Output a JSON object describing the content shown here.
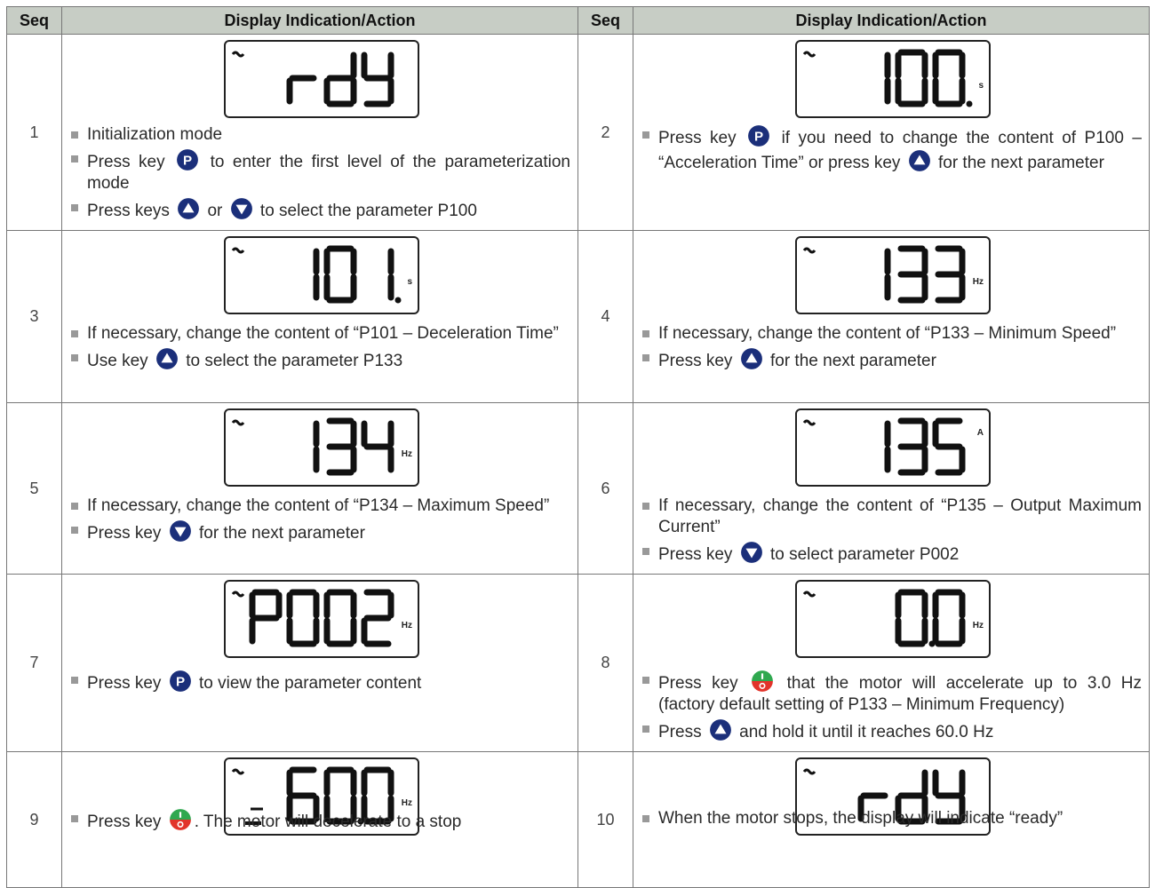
{
  "headers": {
    "seq": "Seq",
    "action": "Display Indication/Action"
  },
  "colors": {
    "header_bg": "#c7cdc5",
    "key_blue": "#1b2f7a",
    "run_green": "#2fa84f",
    "stop_red": "#e2332a"
  },
  "steps": [
    {
      "num": "1",
      "display": "rdY",
      "unit": "",
      "text": [
        "Initialization mode",
        "Press key [P] to enter the first level of the parameterization mode",
        "Press keys [UP] or [DOWN] to select the parameter P100"
      ]
    },
    {
      "num": "2",
      "display": "P 100.",
      "unit": "s",
      "text": [
        "Press key [P] if you need to change the content of P100 – “Acceleration Time” or press key [UP] for the next parameter"
      ]
    },
    {
      "num": "3",
      "display": "P 101.",
      "unit": "s",
      "text": [
        "If necessary, change the content of “P101 – Deceleration Time”",
        "Use key [UP] to select the parameter P133"
      ]
    },
    {
      "num": "4",
      "display": "P 133",
      "unit": "Hz",
      "text": [
        "If necessary, change the content of “P133 – Minimum Speed”",
        "Press key [UP] for the next parameter"
      ]
    },
    {
      "num": "5",
      "display": "P 134",
      "unit": "Hz",
      "text": [
        "If necessary, change the content of “P134 – Maximum Speed”",
        "Press key [DOWN] for the next parameter"
      ]
    },
    {
      "num": "6",
      "display": "P 135",
      "unit": "A",
      "text": [
        "If necessary, change the content of “P135 – Output Maximum Current”",
        "Press key [DOWN] to select parameter P002"
      ]
    },
    {
      "num": "7",
      "display": "P002",
      "unit": "Hz",
      "text": [
        "Press key [P] to view the parameter content"
      ]
    },
    {
      "num": "8",
      "display": "0.0",
      "unit": "Hz",
      "text": [
        "Press key [RUN] that the motor will accelerate up to 3.0 Hz (factory default setting of P133 – Minimum Frequency)",
        "Press [UP] and hold it until it reaches 60.0 Hz"
      ]
    },
    {
      "num": "9",
      "display": "60.0",
      "unit": "Hz",
      "text": [
        "Press key [RUN]. The motor will decelerate to a stop"
      ]
    },
    {
      "num": "10",
      "display": "rdY",
      "unit": "",
      "text": [
        "When the motor stops, the display will indicate “ready”"
      ]
    }
  ],
  "icons": {
    "p": "p-key-icon",
    "up": "up-key-icon",
    "down": "down-key-icon",
    "run": "run-stop-key-icon"
  }
}
